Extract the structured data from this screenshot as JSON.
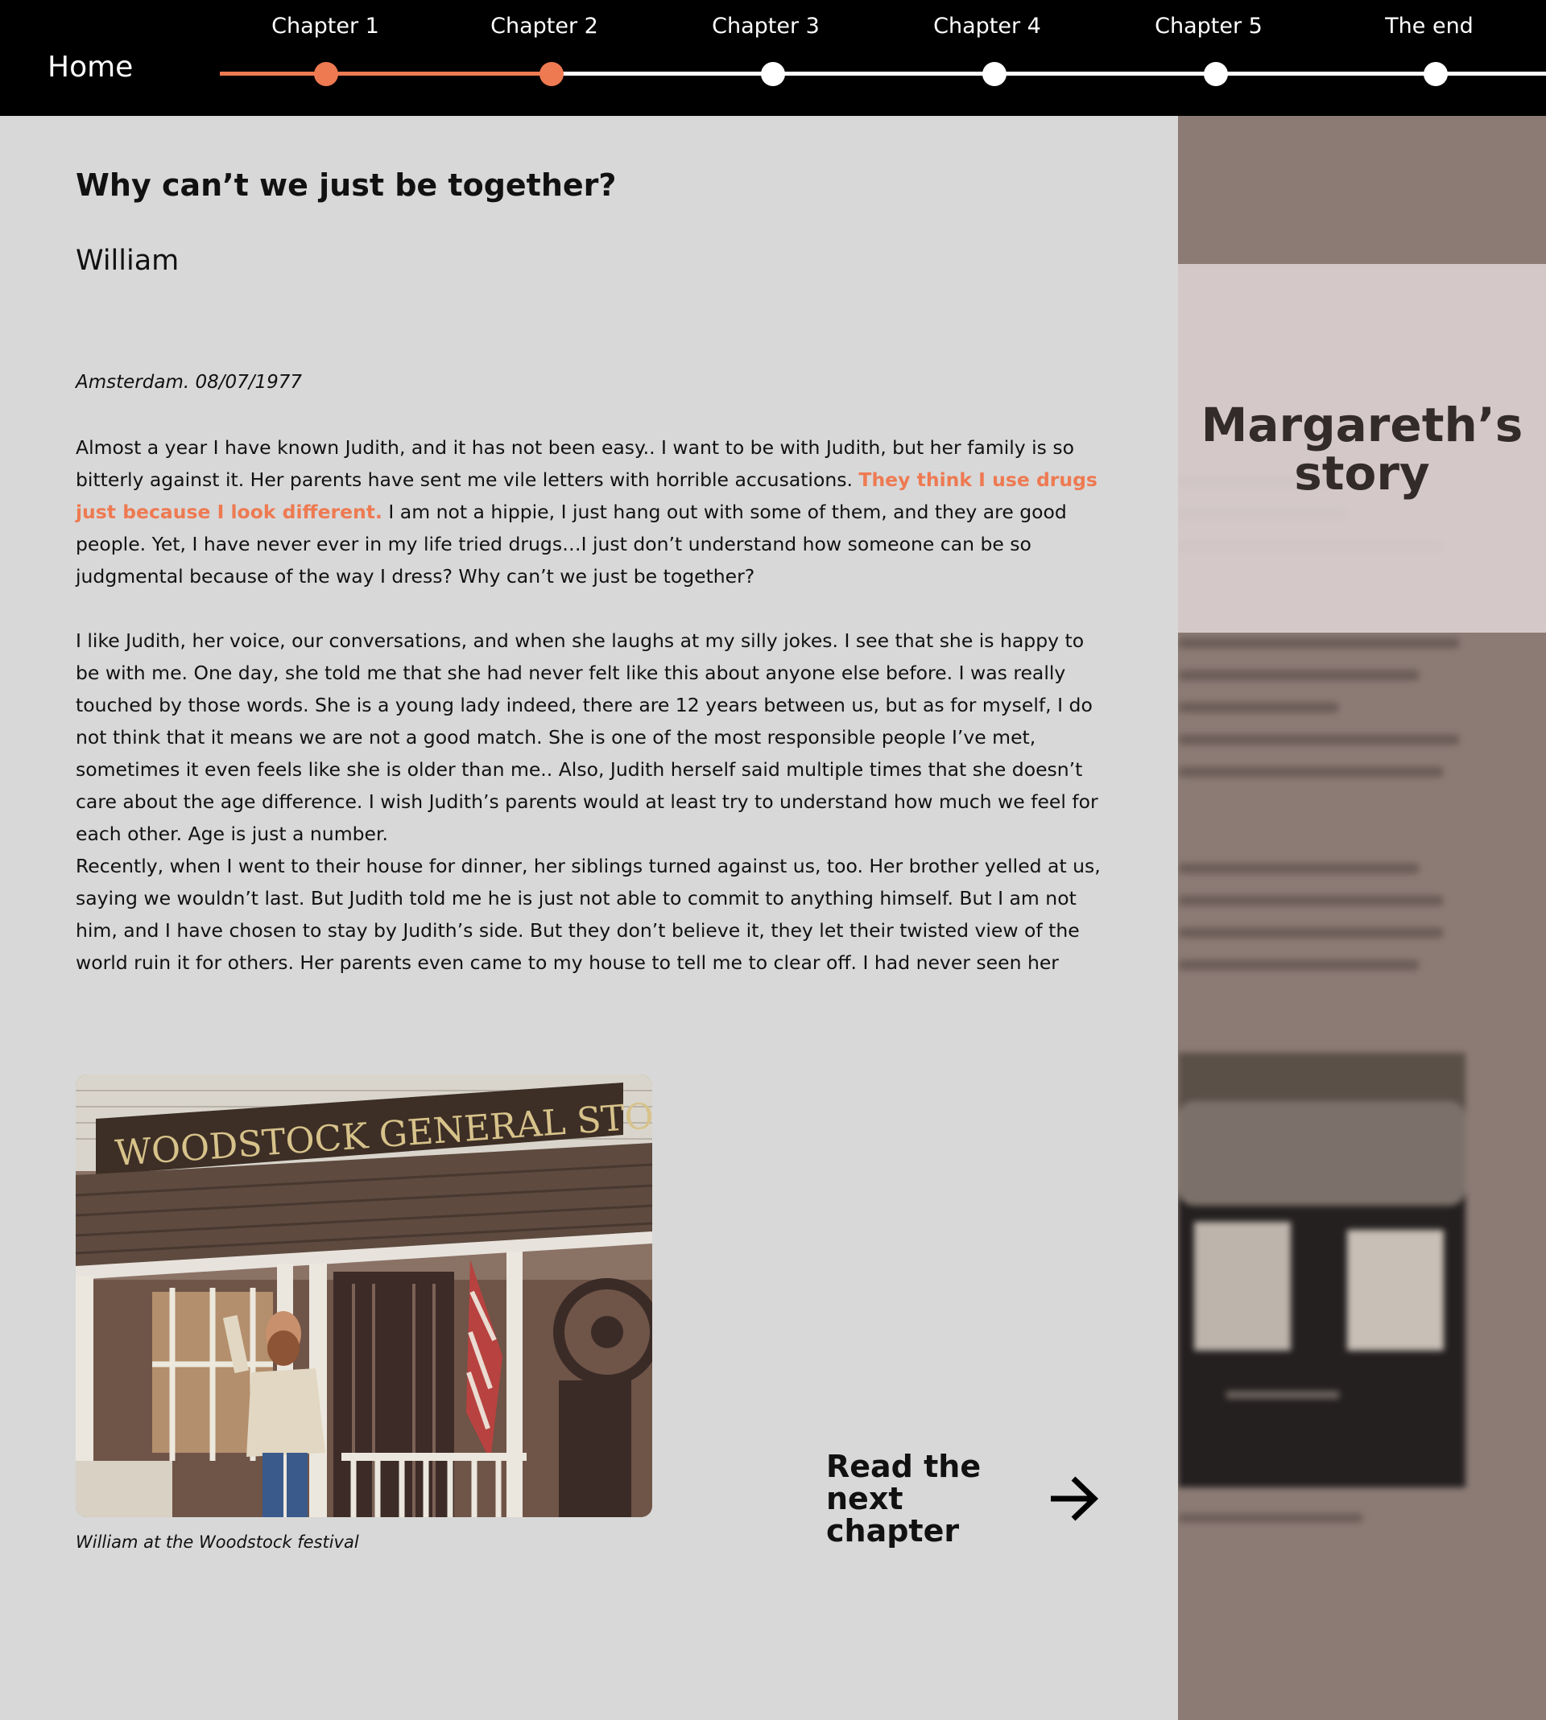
{
  "nav": {
    "home_label": "Home",
    "chapters": [
      "Chapter 1",
      "Chapter 2",
      "Chapter 3",
      "Chapter 4",
      "Chapter 5",
      "The end"
    ],
    "completed_chapters": 2,
    "accent_color": "#ee7a52"
  },
  "article": {
    "title": "Why can’t we just be together?",
    "author": "William",
    "place_date": "Amsterdam. 08/07/1977",
    "p1_before": "Almost a year I  have known Judith, and it has not been easy.. I want to be with Judith, but her family is so bitterly against it. Her parents have sent me vile letters with horrible accusations. ",
    "p1_highlight": "They think I use drugs just because I look different.",
    "p1_after": " I am not a hippie, I just hang out with some of them, and they are good people. Yet, I have never ever in my life tried drugs…I just don’t understand how someone can be so judgmental because of the way I dress? Why can’t we just be together?",
    "p2": "I like Judith, her voice, our conversations, and when she laughs at my silly jokes. I see that she is happy to be with me. One day, she told me that she had never felt like this about anyone else before. I was really touched by those words. She is a young lady indeed, there are 12 years between us, but as for myself, I do not think that it means we are not a good match. She is one of the most responsible people I’ve met, sometimes it even feels like she is older than me.. Also, Judith herself said multiple times that she doesn’t care about the age difference. I wish Judith’s parents would at least try to understand how much we feel for each other. Age is just a number.",
    "p3": "Recently, when I went to their house for dinner, her siblings turned against us, too. Her brother yelled at us, saying we wouldn’t last. But Judith told me he is just not able to commit to anything himself. But I am not him, and I have chosen to stay by Judith’s side. But they don’t believe it, they let their twisted view of the world ruin it for others. Her parents even came to my house to tell me to clear off. I had never seen her father, usually such a calm man, so horribly angry. I felt very threatened, but luckily they left soon. I only care about what Judith thinks of me, and if"
  },
  "photo": {
    "sign_text": "WOODSTOCK GENERAL STORE",
    "caption": "William at the Woodstock festival"
  },
  "next_chapter": {
    "label_line1": "Read the",
    "label_line2": "next chapter"
  },
  "side_panel": {
    "title_line1": "Margareth’s",
    "title_line2": "story"
  }
}
